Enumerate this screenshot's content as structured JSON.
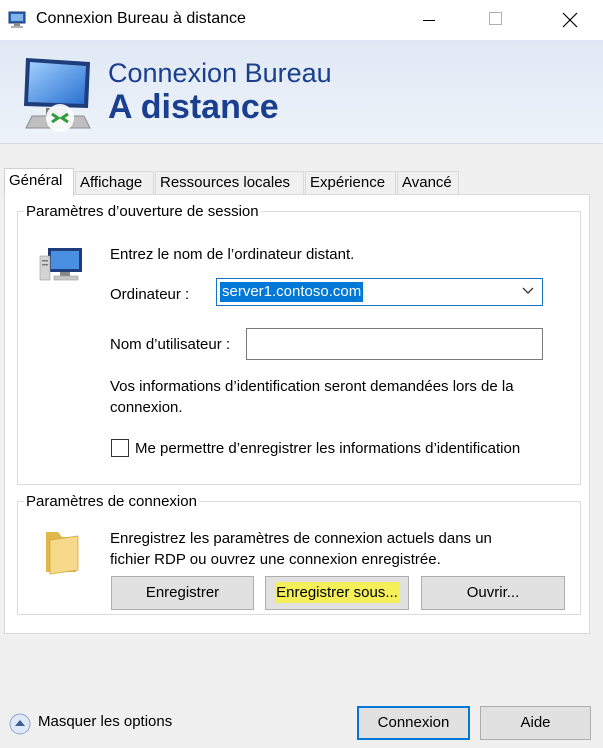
{
  "window": {
    "title": "Connexion Bureau à distance"
  },
  "banner": {
    "line1": "Connexion Bureau",
    "line2": "A distance"
  },
  "tabs": [
    {
      "label": "Général",
      "active": true
    },
    {
      "label": "Affichage"
    },
    {
      "label": "Ressources locales"
    },
    {
      "label": "Expérience"
    },
    {
      "label": "Avancé"
    }
  ],
  "logon": {
    "legend": "Paramètres d’ouverture de session",
    "intro": "Entrez le nom de l’ordinateur distant.",
    "computer_label": "Ordinateur :",
    "computer_value": "server1.contoso.com",
    "username_label": "Nom d’utilisateur :",
    "username_value": "",
    "info_text": "Vos informations d’identification seront demandées lors de la connexion.",
    "remember_label": "Me permettre d’enregistrer les informations d’identification",
    "remember_checked": false
  },
  "connection": {
    "legend": "Paramètres de connexion",
    "description": "Enregistrez les paramètres de connexion actuels dans un fichier RDP ou ouvrez une connexion enregistrée.",
    "save_label": "Enregistrer",
    "save_as_label": "Enregistrer sous...",
    "open_label": "Ouvrir..."
  },
  "footer": {
    "hide_options_label": "Masquer les options",
    "connect_label": "Connexion",
    "help_label": "Aide"
  },
  "colors": {
    "accent": "#0078d7",
    "banner_text": "#1a3f8f",
    "highlight": "#f5f05a"
  },
  "icons": {
    "app": "remote-desktop-icon",
    "banner": "remote-desktop-monitor-icon",
    "logon": "computer-icon",
    "connection": "folder-icon",
    "toggle": "chevron-up-circle-icon"
  }
}
